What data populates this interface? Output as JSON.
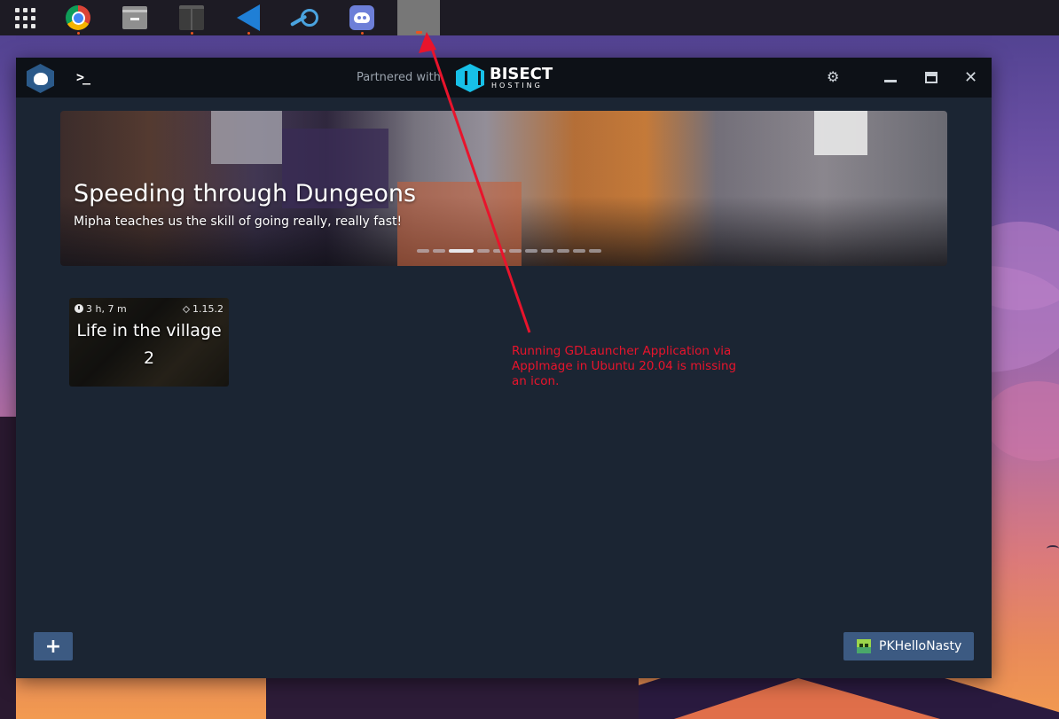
{
  "taskbar": {
    "items": [
      {
        "icon": "app-grid-icon",
        "running": false
      },
      {
        "icon": "chrome-icon",
        "running": true
      },
      {
        "icon": "files-icon",
        "running": false
      },
      {
        "icon": "terminal-icon",
        "running": true
      },
      {
        "icon": "vscode-icon",
        "running": true
      },
      {
        "icon": "steam-icon",
        "running": false
      },
      {
        "icon": "discord-icon",
        "running": true
      },
      {
        "icon": "missing-app-icon",
        "running": true
      }
    ]
  },
  "window": {
    "partner_label": "Partnered with",
    "partner_brand": "BISECT",
    "partner_brand_sub": "HOSTING",
    "banner": {
      "title": "Speeding through Dungeons",
      "subtitle": "Mipha teaches us the skill of going really, really fast!",
      "slide_count": 11,
      "active_slide": 2
    },
    "instances": [
      {
        "playtime": "3 h, 7 m",
        "version": "1.15.2",
        "name": "Life in the village 2"
      }
    ],
    "add_label": "+",
    "account_name": "PKHelloNasty"
  },
  "annotation": {
    "text": "Running GDLauncher Application via AppImage in Ubuntu 20.04 is missing an icon.",
    "color": "#e8142c"
  },
  "colors": {
    "window_bg": "#1b2533",
    "titlebar_bg": "#0d1117",
    "button_bg": "#3c5a82",
    "bisect_accent": "#17c0e8"
  }
}
